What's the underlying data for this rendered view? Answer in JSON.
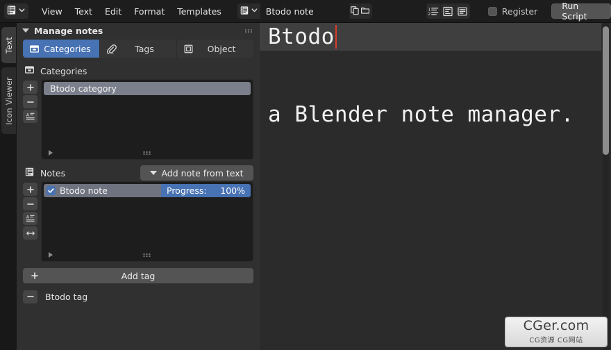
{
  "header": {
    "editor_type_icon": "text-editor-icon",
    "menus": [
      {
        "label": "View"
      },
      {
        "label": "Text"
      },
      {
        "label": "Edit"
      },
      {
        "label": "Format"
      },
      {
        "label": "Templates"
      }
    ],
    "datablock": {
      "icon": "text-datablock-icon",
      "name": "Btodo note",
      "duplicate_icon": "duplicate-icon",
      "open_icon": "open-folder-icon",
      "unlink_icon": "close-x-icon"
    },
    "toggles": [
      {
        "name": "line-numbers-toggle"
      },
      {
        "name": "word-wrap-toggle"
      },
      {
        "name": "syntax-highlight-toggle"
      }
    ],
    "register_label": "Register",
    "register_checked": false,
    "run_script_label": "Run Script"
  },
  "vertical_tabs": [
    {
      "label": "Text",
      "active": true
    },
    {
      "label": "Icon Viewer",
      "active": false
    }
  ],
  "panel": {
    "title": "Manage notes",
    "tabs": [
      {
        "label": "Categories",
        "icon": "archive-box-icon",
        "active": true
      },
      {
        "label": "Tags",
        "icon": "paperclip-icon",
        "active": false
      },
      {
        "label": "Object",
        "icon": "cube-icon",
        "active": false
      }
    ],
    "categories": {
      "section_label": "Categories",
      "section_icon": "archive-box-icon",
      "side_buttons": [
        {
          "name": "add-category-button",
          "glyph": "+"
        },
        {
          "name": "remove-category-button",
          "glyph": "-"
        },
        {
          "name": "sort-categories-button",
          "glyph": "sort-alpha-icon"
        }
      ],
      "items": [
        {
          "label": "Btodo category",
          "selected": true
        }
      ]
    },
    "notes": {
      "section_label": "Notes",
      "section_icon": "notes-icon",
      "add_note_label": "Add note from text",
      "side_buttons": [
        {
          "name": "add-note-button",
          "glyph": "+"
        },
        {
          "name": "remove-note-button",
          "glyph": "-"
        },
        {
          "name": "sort-notes-button",
          "glyph": "sort-alpha-icon"
        },
        {
          "name": "move-note-button",
          "glyph": "arrows-lr-icon"
        }
      ],
      "items": [
        {
          "label": "Btodo note",
          "checked": true,
          "progress_label": "Progress:",
          "progress_value": "100%"
        }
      ]
    },
    "tags": {
      "add_tag_label": "Add tag",
      "items": [
        {
          "label": "Btodo tag"
        }
      ]
    }
  },
  "editor": {
    "line1": "Btodo",
    "line2": "a Blender note manager."
  },
  "watermark": {
    "main": "CGer.com",
    "sub": "CG资源 CG网站"
  },
  "colors": {
    "accent_blue": "#4772b3",
    "panel_bg": "#303030",
    "editor_bg": "#2b2b2b",
    "header_bg": "#1d1d1d",
    "caret_red": "#d83b2b"
  }
}
